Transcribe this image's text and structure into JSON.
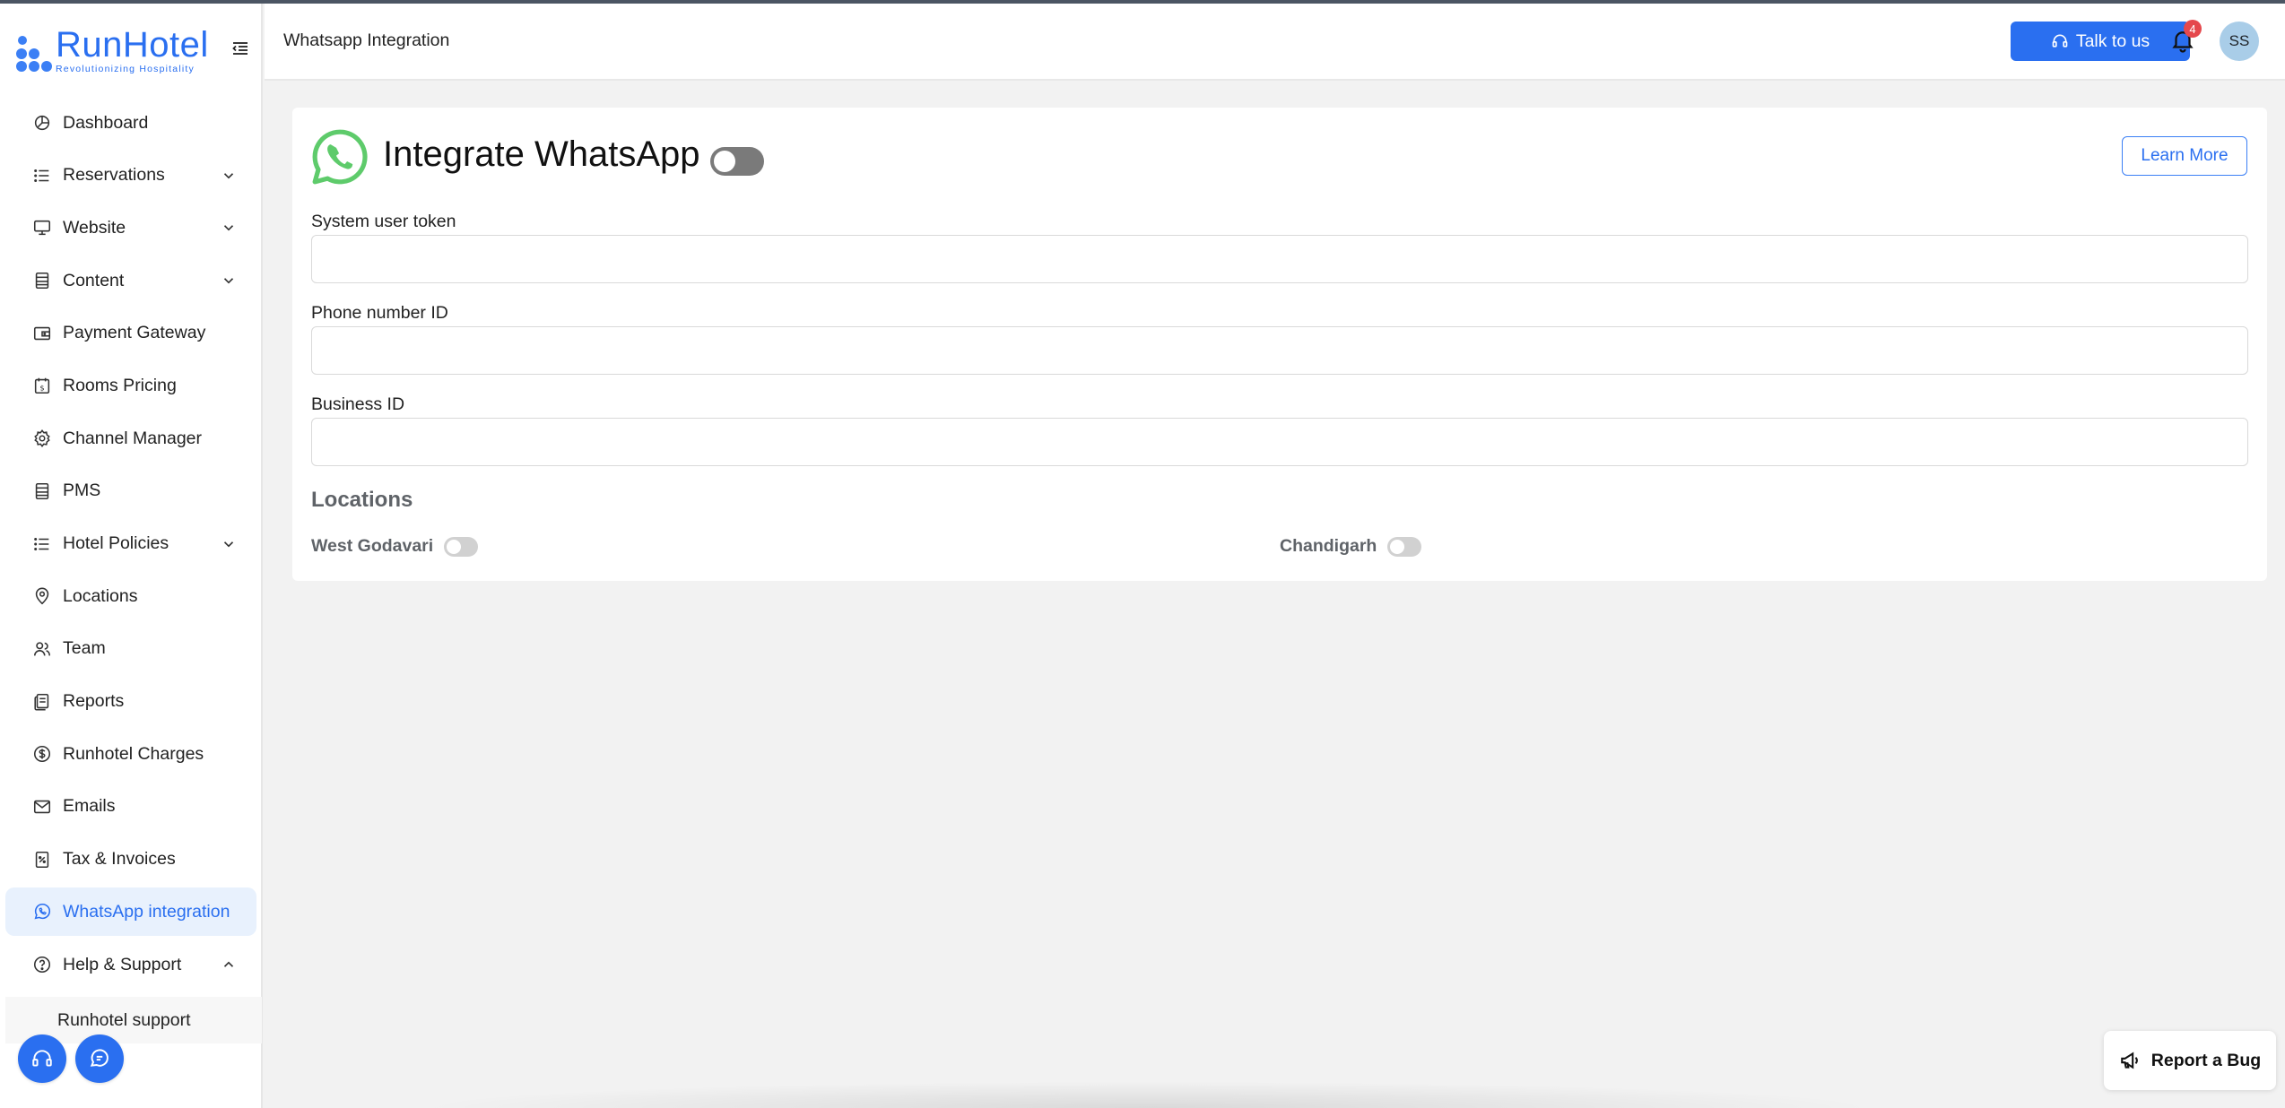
{
  "brand": {
    "name": "RunHotel",
    "tagline": "Revolutionizing Hospitality",
    "color": "#2a6ff0"
  },
  "sidebar": {
    "items": [
      {
        "label": "Dashboard",
        "icon": "dashboard-icon",
        "expandable": false
      },
      {
        "label": "Reservations",
        "icon": "list-icon",
        "expandable": true
      },
      {
        "label": "Website",
        "icon": "monitor-icon",
        "expandable": true
      },
      {
        "label": "Content",
        "icon": "document-icon",
        "expandable": true
      },
      {
        "label": "Payment Gateway",
        "icon": "wallet-icon",
        "expandable": false
      },
      {
        "label": "Rooms Pricing",
        "icon": "price-calendar-icon",
        "expandable": false
      },
      {
        "label": "Channel Manager",
        "icon": "gear-icon",
        "expandable": false
      },
      {
        "label": "PMS",
        "icon": "document-icon",
        "expandable": false
      },
      {
        "label": "Hotel Policies",
        "icon": "list-icon",
        "expandable": true
      },
      {
        "label": "Locations",
        "icon": "location-pin-icon",
        "expandable": false
      },
      {
        "label": "Team",
        "icon": "team-icon",
        "expandable": false
      },
      {
        "label": "Reports",
        "icon": "reports-icon",
        "expandable": false
      },
      {
        "label": "Runhotel Charges",
        "icon": "dollar-icon",
        "expandable": false
      },
      {
        "label": "Emails",
        "icon": "mail-icon",
        "expandable": false
      },
      {
        "label": "Tax & Invoices",
        "icon": "invoice-icon",
        "expandable": false
      },
      {
        "label": "WhatsApp integration",
        "icon": "whatsapp-icon",
        "expandable": false,
        "active": true
      },
      {
        "label": "Help & Support",
        "icon": "help-icon",
        "expandable": true,
        "expanded": true
      }
    ],
    "subitems": [
      {
        "label": "Runhotel support"
      }
    ],
    "active_color": "#2a6ff0",
    "active_bg": "#e8f1fd"
  },
  "header": {
    "title": "Whatsapp Integration",
    "talk_label": "Talk to us",
    "notification_count": "4",
    "avatar_initials": "SS"
  },
  "card": {
    "title": "Integrate WhatsApp",
    "integration_enabled": false,
    "learn_more_label": "Learn More",
    "fields": [
      {
        "label": "System user token",
        "value": "",
        "placeholder": ""
      },
      {
        "label": "Phone number ID",
        "value": "",
        "placeholder": ""
      },
      {
        "label": "Business ID",
        "value": "",
        "placeholder": ""
      }
    ],
    "locations_title": "Locations",
    "locations": [
      {
        "name": "West Godavari",
        "enabled": false
      },
      {
        "name": "Chandigarh",
        "enabled": false
      }
    ],
    "whatsapp_color": "#5ecb6b"
  },
  "report_bug_label": "Report a Bug"
}
